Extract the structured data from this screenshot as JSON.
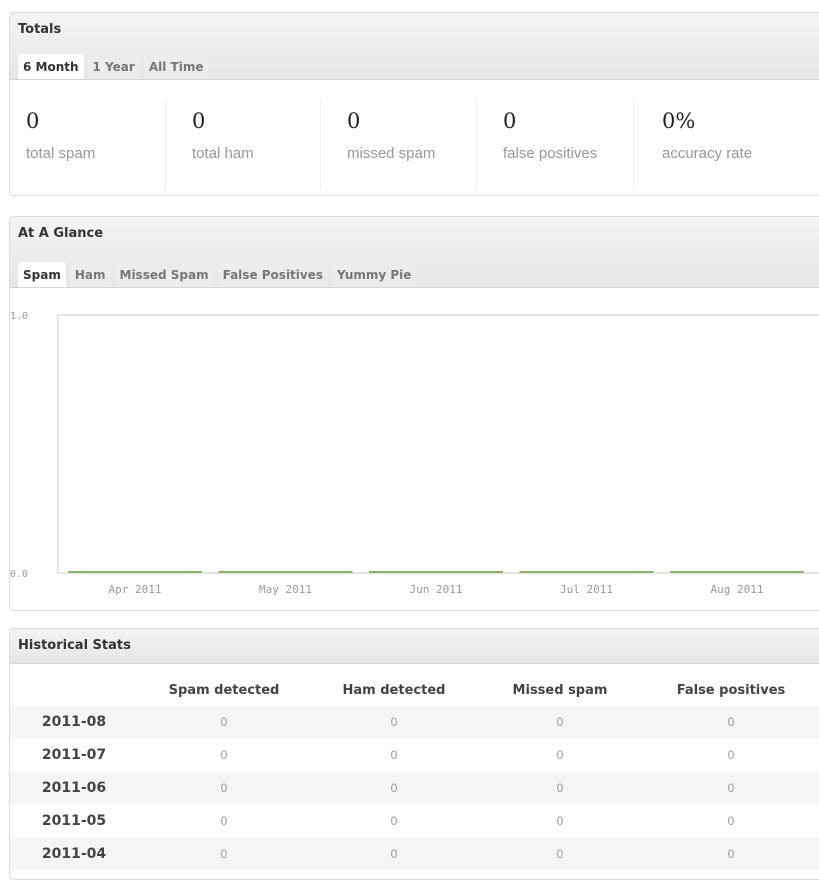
{
  "totals": {
    "title": "Totals",
    "tabs": [
      {
        "label": "6 Month",
        "active": true
      },
      {
        "label": "1 Year",
        "active": false
      },
      {
        "label": "All Time",
        "active": false
      }
    ],
    "stats": [
      {
        "value": "0",
        "label": "total spam"
      },
      {
        "value": "0",
        "label": "total ham"
      },
      {
        "value": "0",
        "label": "missed spam"
      },
      {
        "value": "0",
        "label": "false positives"
      },
      {
        "value": "0%",
        "label": "accuracy rate"
      }
    ]
  },
  "glance": {
    "title": "At A Glance",
    "tabs": [
      {
        "label": "Spam",
        "active": true
      },
      {
        "label": "Ham",
        "active": false
      },
      {
        "label": "Missed Spam",
        "active": false
      },
      {
        "label": "False Positives",
        "active": false
      },
      {
        "label": "Yummy Pie",
        "active": false
      }
    ]
  },
  "chart_data": {
    "type": "bar",
    "categories": [
      "Apr 2011",
      "May 2011",
      "Jun 2011",
      "Jul 2011",
      "Aug 2011"
    ],
    "values": [
      0,
      0,
      0,
      0,
      0
    ],
    "ylim": [
      0.0,
      1.0
    ],
    "yticks": [
      "1.0",
      "0.0"
    ],
    "series_color": "#8cb36a",
    "grid": false
  },
  "historical": {
    "title": "Historical Stats",
    "columns": [
      "",
      "Spam detected",
      "Ham detected",
      "Missed spam",
      "False positives"
    ],
    "rows": [
      {
        "month": "2011-08",
        "values": [
          "0",
          "0",
          "0",
          "0"
        ]
      },
      {
        "month": "2011-07",
        "values": [
          "0",
          "0",
          "0",
          "0"
        ]
      },
      {
        "month": "2011-06",
        "values": [
          "0",
          "0",
          "0",
          "0"
        ]
      },
      {
        "month": "2011-05",
        "values": [
          "0",
          "0",
          "0",
          "0"
        ]
      },
      {
        "month": "2011-04",
        "values": [
          "0",
          "0",
          "0",
          "0"
        ]
      }
    ]
  }
}
